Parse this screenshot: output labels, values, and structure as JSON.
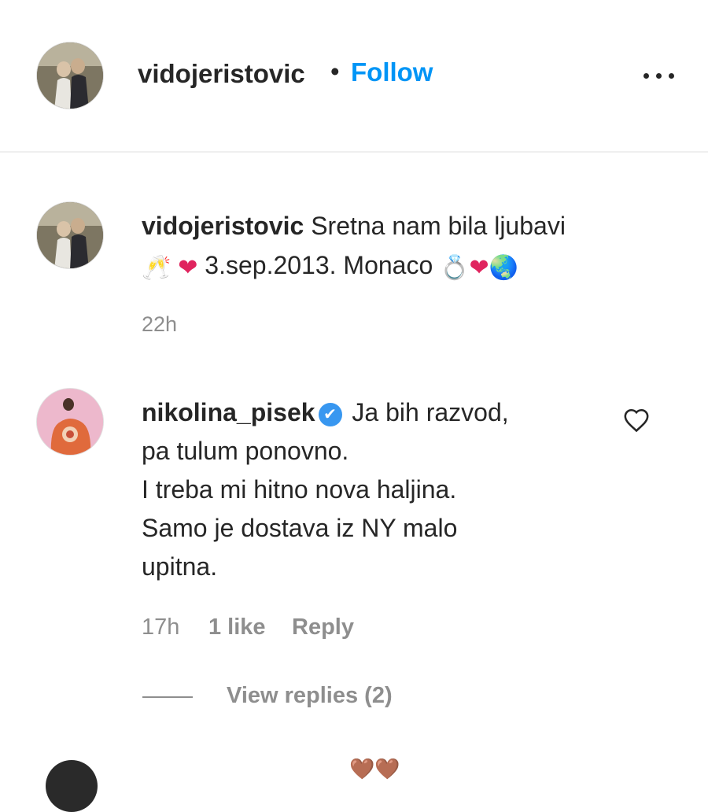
{
  "header": {
    "username": "vidojeristovic",
    "separator": "•",
    "follow_label": "Follow",
    "more_icon": "more-horizontal-icon"
  },
  "caption": {
    "username": "vidojeristovic",
    "text_line1": "Sretna nam bila ljubavi",
    "text_line2_part1": "3.sep.2013. Monaco",
    "emoji_champagne": "🥂",
    "emoji_heart": "❤",
    "emoji_ring": "💍",
    "emoji_globe": "🌏",
    "time": "22h"
  },
  "comment": {
    "username": "nikolina_pisek",
    "verified_mark": "✔",
    "lines": [
      "Ja bih razvod,",
      "pa tulum ponovno.",
      "I treba mi hitno nova haljina.",
      "Samo je dostava iz NY malo",
      "upitna."
    ],
    "time": "17h",
    "likes": "1 like",
    "reply_label": "Reply",
    "view_replies": "View replies (2)",
    "like_icon": "heart-outline-icon"
  },
  "next_comment": {
    "emoji": "🤎🤎"
  }
}
